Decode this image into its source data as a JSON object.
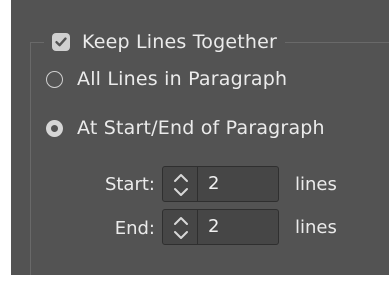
{
  "keep_lines": {
    "label": "Keep Lines Together",
    "checked": true
  },
  "options": [
    {
      "label": "All Lines in Paragraph",
      "selected": false
    },
    {
      "label": "At Start/End of Paragraph",
      "selected": true
    }
  ],
  "start": {
    "label": "Start:",
    "value": "2",
    "unit": "lines"
  },
  "end": {
    "label": "End:",
    "value": "2",
    "unit": "lines"
  },
  "colors": {
    "panel_bg": "#535353",
    "text": "#ebebeb",
    "input_bg": "#464646",
    "input_border": "#2f2f2f"
  }
}
